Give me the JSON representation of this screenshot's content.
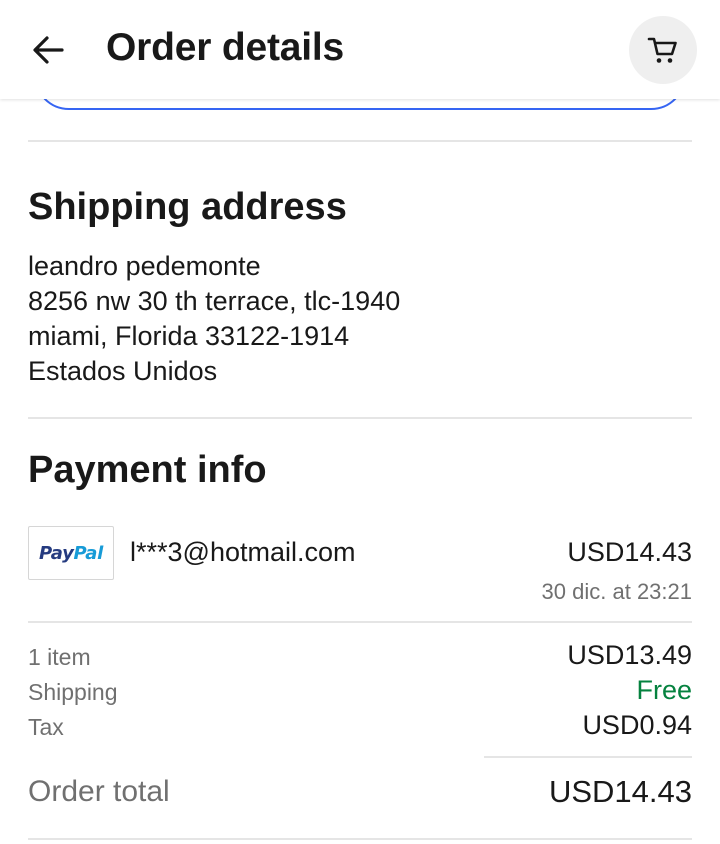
{
  "header": {
    "title": "Order details",
    "back_icon": "arrow-left-icon",
    "cart_icon": "shopping-cart-icon"
  },
  "shipping": {
    "title": "Shipping address",
    "lines": [
      "leandro pedemonte",
      "8256 nw 30 th terrace, tlc-1940",
      "miami, Florida 33122-1914",
      "Estados Unidos"
    ]
  },
  "payment": {
    "title": "Payment info",
    "method_logo_parts": [
      "Pay",
      "Pal"
    ],
    "email": "l***3@hotmail.com",
    "amount": "USD14.43",
    "date": "30 dic. at 23:21"
  },
  "summary": {
    "rows": [
      {
        "label": "1 item",
        "value": "USD13.49"
      },
      {
        "label": "Shipping",
        "value": "Free"
      },
      {
        "label": "Tax",
        "value": "USD0.94"
      }
    ],
    "total_label": "Order total",
    "total_value": "USD14.43"
  },
  "colors": {
    "accent_blue": "#3665f3",
    "free_green": "#05823f",
    "muted_text": "#707070",
    "paypal_dark": "#253b80",
    "paypal_light": "#179bd7"
  }
}
